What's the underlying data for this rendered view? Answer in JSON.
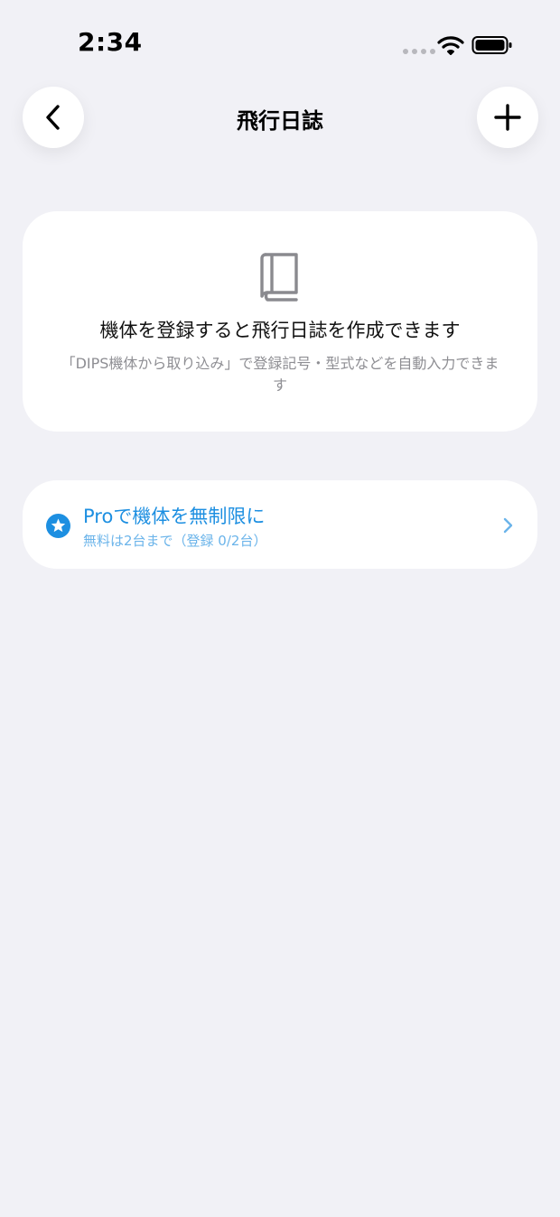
{
  "status_bar": {
    "time": "2:34"
  },
  "nav": {
    "title": "飛行日誌",
    "back_icon": "chevron-left-icon",
    "add_icon": "plus-icon"
  },
  "empty_state": {
    "icon": "book-icon",
    "title": "機体を登録すると飛行日誌を作成できます",
    "description": "「DIPS機体から取り込み」で登録記号・型式などを自動入力できます"
  },
  "pro_banner": {
    "icon": "star-badge-icon",
    "title": "Proで機体を無制限に",
    "subtitle": "無料は2台まで（登録 0/2台）",
    "accent_color": "#1d8fe1"
  }
}
